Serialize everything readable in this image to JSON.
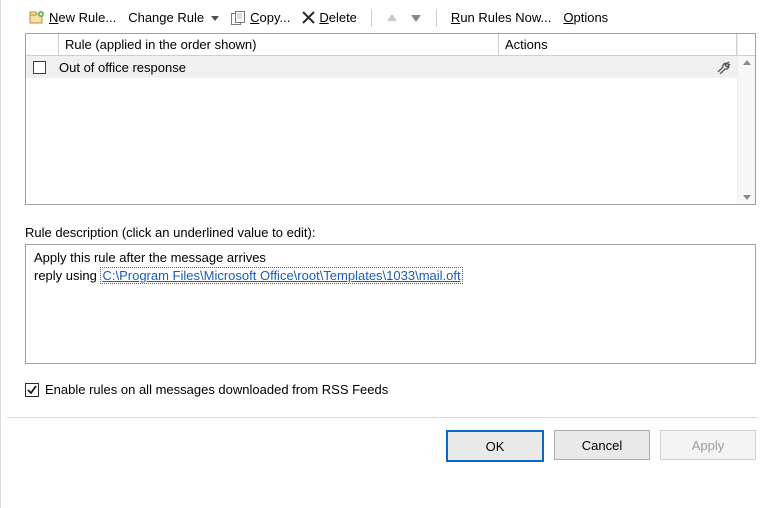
{
  "toolbar": {
    "new_rule_pre": "N",
    "new_rule_rest": "ew Rule...",
    "change_rule_label": "Change Rule",
    "copy_pre": "C",
    "copy_rest": "opy...",
    "delete_pre": "D",
    "delete_rest": "elete",
    "run_rules_pre": "R",
    "run_rules_rest": "un Rules Now...",
    "options_pre": "O",
    "options_rest": "ptions"
  },
  "rules_table": {
    "header_rule": "Rule (applied in the order shown)",
    "header_actions": "Actions",
    "rows": [
      {
        "name": "Out of office response",
        "checked": false
      }
    ]
  },
  "description": {
    "label": "Rule description (click an underlined value to edit):",
    "line1": "Apply this rule after the message arrives",
    "line2_prefix": "reply using ",
    "line2_link": "C:\\Program Files\\Microsoft Office\\root\\Templates\\1033\\mail.oft"
  },
  "rss": {
    "label": "Enable rules on all messages downloaded from RSS Feeds",
    "checked": true
  },
  "buttons": {
    "ok": "OK",
    "cancel": "Cancel",
    "apply": "Apply"
  }
}
